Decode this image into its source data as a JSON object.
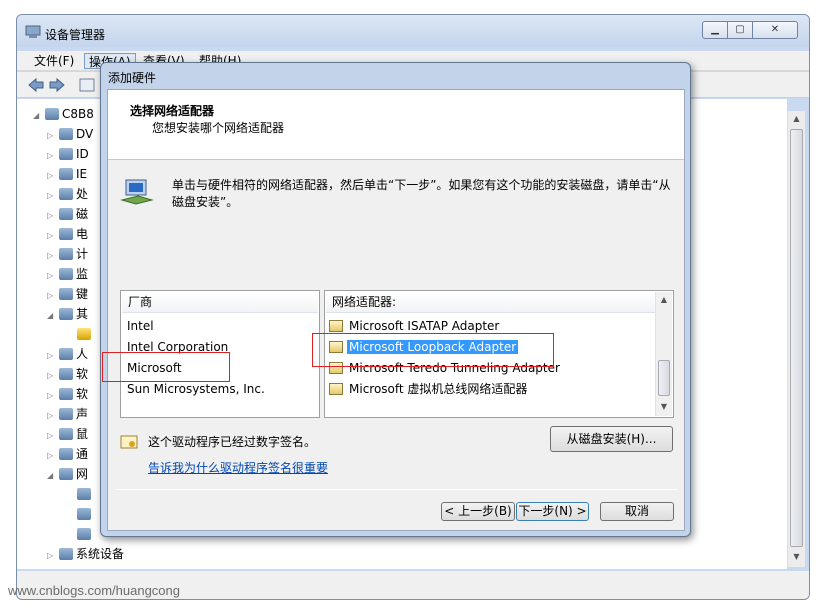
{
  "main_window": {
    "title": "设备管理器",
    "menu": [
      "文件(F)",
      "操作(A)",
      "查看(V)",
      "帮助(H)"
    ],
    "tree": [
      {
        "arrow": "◢",
        "label": "C8B8"
      },
      {
        "arrow": "▷",
        "label": "DV"
      },
      {
        "arrow": "▷",
        "label": "ID"
      },
      {
        "arrow": "▷",
        "label": "IE"
      },
      {
        "arrow": "▷",
        "label": "处"
      },
      {
        "arrow": "▷",
        "label": "磁"
      },
      {
        "arrow": "▷",
        "label": "电"
      },
      {
        "arrow": "▷",
        "label": "计"
      },
      {
        "arrow": "▷",
        "label": "监"
      },
      {
        "arrow": "▷",
        "label": "键"
      },
      {
        "arrow": "◢",
        "label": "其"
      },
      {
        "arrow": "",
        "label": ""
      },
      {
        "arrow": "▷",
        "label": "人"
      },
      {
        "arrow": "▷",
        "label": "软"
      },
      {
        "arrow": "▷",
        "label": "软"
      },
      {
        "arrow": "▷",
        "label": "声"
      },
      {
        "arrow": "▷",
        "label": "鼠"
      },
      {
        "arrow": "▷",
        "label": "通"
      },
      {
        "arrow": "◢",
        "label": "网"
      },
      {
        "arrow": "",
        "label": ""
      },
      {
        "arrow": "",
        "label": ""
      },
      {
        "arrow": "",
        "label": ""
      },
      {
        "arrow": "▷",
        "label": "系统设备"
      }
    ],
    "watermark": "www.cnblogs.com/huangcong"
  },
  "dialog": {
    "title": "添加硬件",
    "heading": "选择网络适配器",
    "subheading": "您想安装哪个网络适配器",
    "instruction": "单击与硬件相符的网络适配器，然后单击“下一步”。如果您有这个功能的安装磁盘，请单击“从磁盘安装”。",
    "manufacturer_header": "厂商",
    "manufacturers": [
      "Intel",
      "Intel Corporation",
      "Microsoft",
      "Sun Microsystems, Inc."
    ],
    "adapter_header": "网络适配器:",
    "adapters": [
      "Microsoft ISATAP Adapter",
      "Microsoft Loopback Adapter",
      "Microsoft Teredo Tunneling Adapter",
      "Microsoft 虚拟机总线网络适配器"
    ],
    "selected_adapter": 1,
    "signed_text": "这个驱动程序已经过数字签名。",
    "signed_link": "告诉我为什么驱动程序签名很重要",
    "have_disk_label": "从磁盘安装(H)...",
    "back_label": "< 上一步(B)",
    "next_label": "下一步(N) >",
    "cancel_label": "取消"
  }
}
